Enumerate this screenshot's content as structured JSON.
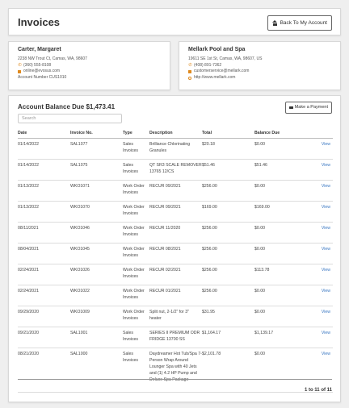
{
  "header": {
    "title": "Invoices",
    "back_label": "Back To My Account"
  },
  "customer": {
    "name": "Carter, Margaret",
    "address": "2238 NW Trout Ct, Camas, WA, 98607",
    "phone": "(360) 555-8108",
    "email": "online@evosus.com",
    "account": "Account Number CUS1010"
  },
  "company": {
    "name": "Mellark Pool and Spa",
    "address": "19611 SE 1st St, Camas, WA, 98607, US",
    "phone": "(408) 891-7362",
    "email": "customerservice@mellark.com",
    "website": "http://www.mellark.com"
  },
  "balance": {
    "title": "Account Balance Due $1,473.41",
    "pay_label": "Make a Payment",
    "search_placeholder": "Search",
    "columns": [
      "Date",
      "Invoice No.",
      "Type",
      "Description",
      "Total",
      "Balance Due",
      ""
    ],
    "rows": [
      {
        "date": "01/14/2022",
        "inv": "SAL1077",
        "type": "Sales Invoices",
        "desc": "Brilliance Chlorinating Granules",
        "total": "$20.18",
        "bal": "$0.00",
        "view": "View"
      },
      {
        "date": "01/14/2022",
        "inv": "SAL1075",
        "type": "Sales Invoices",
        "desc": "QT SR3 SCALE REMOVER 13765 12/CS",
        "total": "$51.46",
        "bal": "$51.46",
        "view": "View"
      },
      {
        "date": "01/13/2022",
        "inv": "WKO1071",
        "type": "Work Order Invoices",
        "desc": "RECUR 09/2021",
        "total": "$256.00",
        "bal": "$0.00",
        "view": "View"
      },
      {
        "date": "01/13/2022",
        "inv": "WKO1070",
        "type": "Work Order Invoices",
        "desc": "RECUR 09/2021",
        "total": "$169.00",
        "bal": "$169.00",
        "view": "View"
      },
      {
        "date": "08/11/2021",
        "inv": "WKO1046",
        "type": "Work Order Invoices",
        "desc": "RECUR 11/2020",
        "total": "$256.00",
        "bal": "$0.00",
        "view": "View"
      },
      {
        "date": "08/04/2021",
        "inv": "WKO1045",
        "type": "Work Order Invoices",
        "desc": "RECUR 08/2021",
        "total": "$256.00",
        "bal": "$0.00",
        "view": "View"
      },
      {
        "date": "02/24/2021",
        "inv": "WKO1026",
        "type": "Work Order Invoices",
        "desc": "RECUR 02/2021",
        "total": "$256.00",
        "bal": "$113.78",
        "view": "View"
      },
      {
        "date": "02/24/2021",
        "inv": "WKO1022",
        "type": "Work Order Invoices",
        "desc": "RECUR 01/2021",
        "total": "$256.00",
        "bal": "$0.00",
        "view": "View"
      },
      {
        "date": "09/29/2020",
        "inv": "WKO1009",
        "type": "Work Order Invoices",
        "desc": "Split nut, 2-1/2\" for 3\" heater",
        "total": "$31.95",
        "bal": "$0.00",
        "view": "View"
      },
      {
        "date": "09/21/2020",
        "inv": "SAL1001",
        "type": "Sales Invoices",
        "desc": "SERIES II PREMIUM ODR FRIDGE 13700 SS",
        "total": "$1,164.17",
        "bal": "$1,139.17",
        "view": "View"
      },
      {
        "date": "08/21/2020",
        "inv": "SAL1000",
        "type": "Sales Invoices",
        "desc": "Daydreamer Hot Tub/Spa 7-Person Wrap Around Lounger Spa with 40 Jets and (1) 4.2 HP Pump and Deluxe Spa Package",
        "total": "$2,101.78",
        "bal": "$0.00",
        "view": "View"
      }
    ],
    "pager": "1 to 11 of 11"
  }
}
